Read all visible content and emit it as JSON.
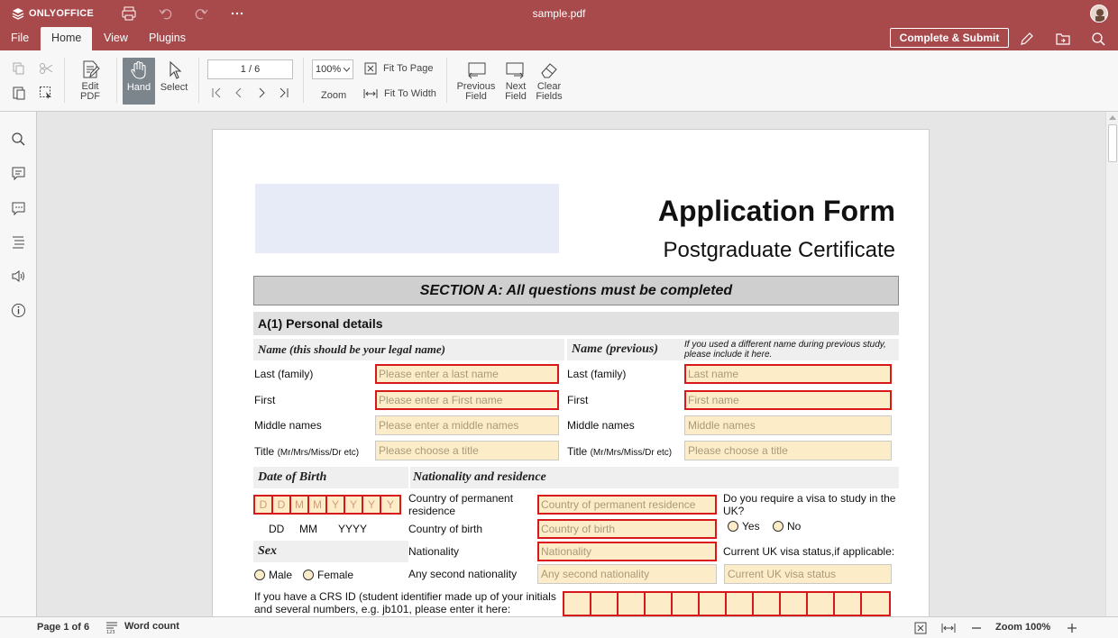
{
  "app": {
    "brand": "ONLYOFFICE",
    "file_name": "sample.pdf"
  },
  "menu": {
    "tabs": [
      "File",
      "Home",
      "View",
      "Plugins"
    ],
    "active": "Home",
    "complete_submit": "Complete & Submit"
  },
  "toolbar": {
    "edit_pdf": [
      "Edit",
      "PDF"
    ],
    "hand": "Hand",
    "select": "Select",
    "page_value": "1 / 6",
    "zoom_value": "100%",
    "zoom_label": "Zoom",
    "fit_to_page": "Fit To Page",
    "fit_to_width": "Fit To Width",
    "previous_field": [
      "Previous",
      "Field"
    ],
    "next_field": [
      "Next",
      "Field"
    ],
    "clear_fields": [
      "Clear",
      "Fields"
    ]
  },
  "form": {
    "title": "Application Form",
    "subtitle": "Postgraduate Certificate",
    "section_a": "SECTION A: All questions must be completed",
    "a1": "A(1) Personal details",
    "name_legal": "Name (this should be your legal name)",
    "name_previous": "Name (previous)",
    "name_previous_note": "If you used a different name during previous study, please include it here.",
    "left": {
      "last_label": "Last (family)",
      "last_ph": "Please enter a last name",
      "first_label": "First",
      "first_ph": "Please enter a First name",
      "middle_label": "Middle names",
      "middle_ph": "Please enter a middle names",
      "title_label": "Title",
      "title_hint": "(Mr/Mrs/Miss/Dr etc)",
      "title_ph": "Please choose a title"
    },
    "right": {
      "last_label": "Last (family)",
      "last_ph": "Last name",
      "first_label": "First",
      "first_ph": "First name",
      "middle_label": "Middle names",
      "middle_ph": "Middle names",
      "title_label": "Title",
      "title_hint": "(Mr/Mrs/Miss/Dr etc)",
      "title_ph": "Please choose a title"
    },
    "dob": {
      "heading": "Date of Birth",
      "cells": [
        "D",
        "D",
        "M",
        "M",
        "Y",
        "Y",
        "Y",
        "Y"
      ],
      "dd": "DD",
      "mm": "MM",
      "yyyy": "YYYY"
    },
    "nationality": {
      "heading": "Nationality and residence",
      "country_perm_label": "Country of permanent residence",
      "country_perm_ph": "Country of permanent residence",
      "country_birth_label": "Country of birth",
      "country_birth_ph": "Country of birth",
      "nationality_label": "Nationality",
      "nationality_ph": "Nationality",
      "second_label": "Any second nationality",
      "second_ph": "Any second nationality",
      "visa_question": "Do you require a visa to study in the UK?",
      "yes": "Yes",
      "no": "No",
      "visa_status_label": "Current UK visa status,if applicable:",
      "visa_status_ph": "Current UK visa status"
    },
    "sex": {
      "heading": "Sex",
      "male": "Male",
      "female": "Female"
    },
    "crs": {
      "text": "If you have a CRS ID (student identifier made up of your initials and several numbers, e.g. jb101, please enter it here:",
      "cells": 12
    }
  },
  "status": {
    "page": "Page 1 of 6",
    "word_count": "Word count",
    "zoom": "Zoom 100%"
  }
}
